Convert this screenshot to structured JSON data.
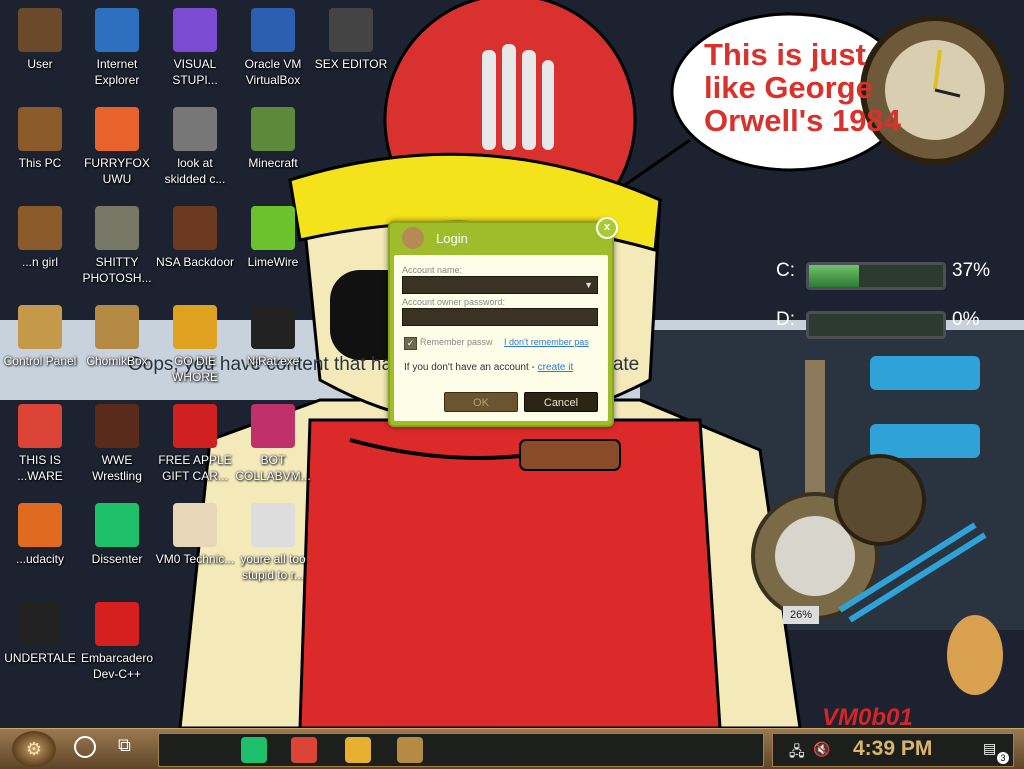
{
  "wallpaper": {
    "speech_bubble": "This is just like George Orwell's 1984",
    "censor_banner": "Oops, you have content that has been deemed inappropriate",
    "watermark": "VM0b01"
  },
  "desktop_icons": [
    {
      "label": "User",
      "icon": "user-folder-icon",
      "color": "#6b4a2b"
    },
    {
      "label": "Internet Explorer",
      "icon": "internet-explorer-icon",
      "color": "#2f6fc0"
    },
    {
      "label": "VISUAL STUPI...",
      "icon": "visual-studio-icon",
      "color": "#7b4bd1"
    },
    {
      "label": "Oracle VM VirtualBox",
      "icon": "virtualbox-icon",
      "color": "#2b5fb0"
    },
    {
      "label": "SEX EDITOR",
      "icon": "editor-icon",
      "color": "#444444"
    },
    {
      "label": "This PC",
      "icon": "this-pc-icon",
      "color": "#8a5a2b"
    },
    {
      "label": "FURRYFOX UWU",
      "icon": "firefox-icon",
      "color": "#e8632b"
    },
    {
      "label": "look at skidded c...",
      "icon": "copy-icon",
      "color": "#777777"
    },
    {
      "label": "Minecraft",
      "icon": "minecraft-icon",
      "color": "#5b8a3a"
    },
    {
      "label": "...n girl",
      "icon": "folder-icon",
      "color": "#8a5a2b"
    },
    {
      "label": "SHITTY PHOTOSH...",
      "icon": "gimp-icon",
      "color": "#777766"
    },
    {
      "label": "NSA Backdoor",
      "icon": "backdoor-icon",
      "color": "#6b3a20"
    },
    {
      "label": "LimeWire",
      "icon": "limewire-icon",
      "color": "#6cc22d"
    },
    {
      "label": "Control Panel",
      "icon": "control-panel-icon",
      "color": "#c49a4a"
    },
    {
      "label": "ChomikBox",
      "icon": "chomikbox-icon",
      "color": "#b58a45"
    },
    {
      "label": "GO DIE WHORE",
      "icon": "de-icon",
      "color": "#e0a020"
    },
    {
      "label": "NjRat.exe",
      "icon": "skull-icon",
      "color": "#222222"
    },
    {
      "label": "THIS IS ...WARE",
      "icon": "chrome-icon",
      "color": "#db4437"
    },
    {
      "label": "WWE Wrestling",
      "icon": "wrestling-icon",
      "color": "#5a2b1a"
    },
    {
      "label": "FREE APPLE GIFT CAR...",
      "icon": "apple-icon",
      "color": "#d02020"
    },
    {
      "label": "BOT COLLABVM...",
      "icon": "monitor-icon",
      "color": "#c0306a"
    },
    {
      "label": "...udacity",
      "icon": "audacity-icon",
      "color": "#e06a20"
    },
    {
      "label": "Dissenter",
      "icon": "dissenter-icon",
      "color": "#1ec06a"
    },
    {
      "label": "VM0 Technic...",
      "icon": "technician-icon",
      "color": "#e8d6b8"
    },
    {
      "label": "youre all too stupid to r...",
      "icon": "portrait-icon",
      "color": "#dddddd"
    },
    {
      "label": "UNDERTALE",
      "icon": "unity-icon",
      "color": "#222222"
    },
    {
      "label": "Embarcadero Dev-C++",
      "icon": "devcpp-icon",
      "color": "#d62020"
    }
  ],
  "widgets": {
    "drives": [
      {
        "letter": "C:",
        "percent_text": "37%",
        "percent": 37
      },
      {
        "letter": "D:",
        "percent_text": "0%",
        "percent": 0
      }
    ],
    "gauge_text": "26%"
  },
  "login_dialog": {
    "title": "Login",
    "close_label": "x",
    "account_name_label": "Account name:",
    "account_owner_password_label": "Account owner password:",
    "account_name_value": "",
    "password_value": "",
    "remember_label": "Remember passw",
    "forgot_link": "I don't remember pas",
    "no_account_text": "If you don't have an account - ",
    "create_link": "create it",
    "ok_label": "OK",
    "cancel_label": "Cancel"
  },
  "taskbar": {
    "start_icon": "start-gear-icon",
    "pinned": [
      {
        "icon": "dissenter-taskbar-icon",
        "color": "#1ec06a"
      },
      {
        "icon": "chrome-taskbar-icon",
        "color": "#db4437"
      },
      {
        "icon": "file-explorer-icon",
        "color": "#e8b030"
      },
      {
        "icon": "chomikbox-taskbar-icon",
        "color": "#b58a45"
      }
    ],
    "clock": "4:39 PM",
    "notification_count": "3"
  }
}
